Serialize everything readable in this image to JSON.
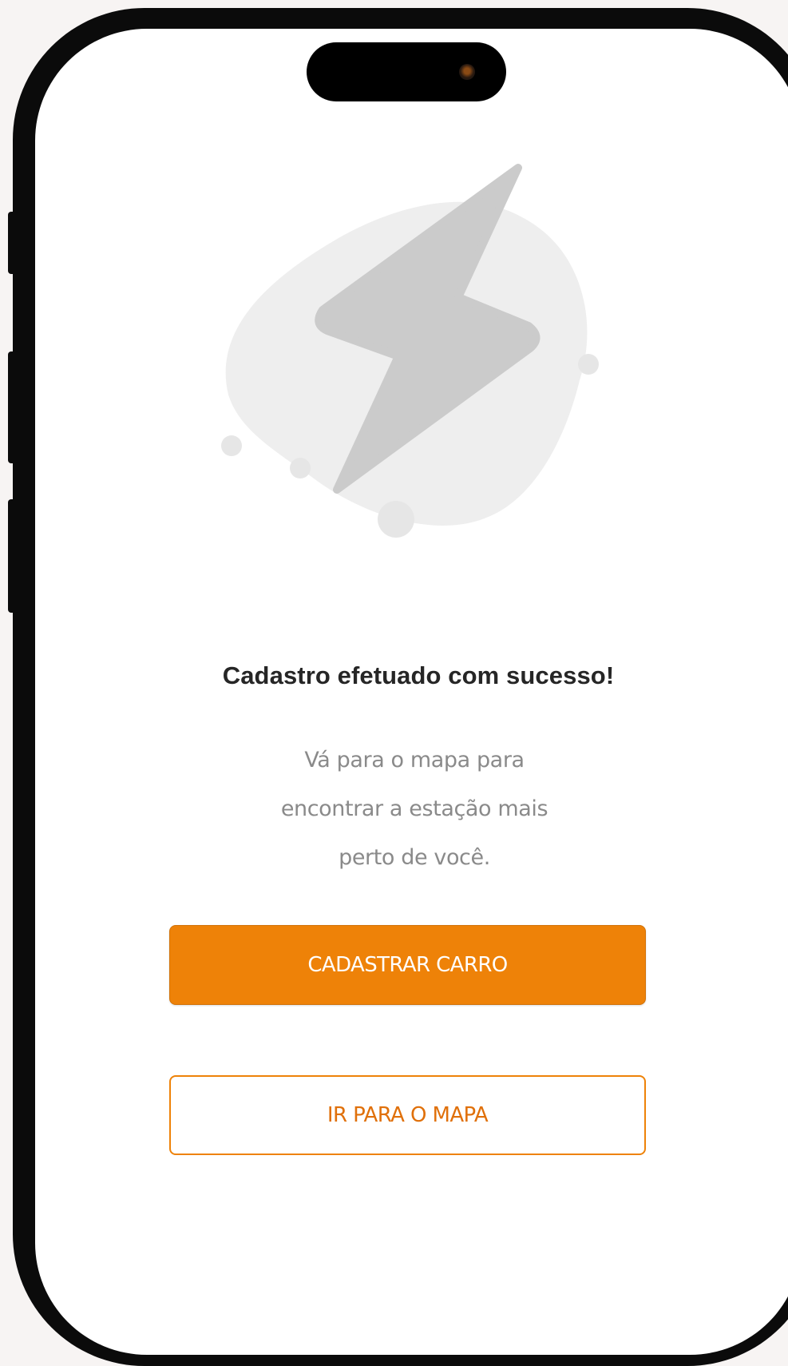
{
  "screen": {
    "title": "Cadastro efetuado com sucesso!",
    "subtitle_lines": [
      "Vá para o mapa para",
      "encontrar a estação mais",
      "perto de você."
    ]
  },
  "actions": {
    "primary_label": "CADASTRAR CARRO",
    "secondary_label": "IR PARA O MAPA"
  },
  "illustration": {
    "icon": "lightning-bolt-icon"
  },
  "colors": {
    "accent": "#ee8208",
    "background": "#f7f4f3",
    "title_text": "#262626",
    "body_text": "#8a8a8a"
  }
}
